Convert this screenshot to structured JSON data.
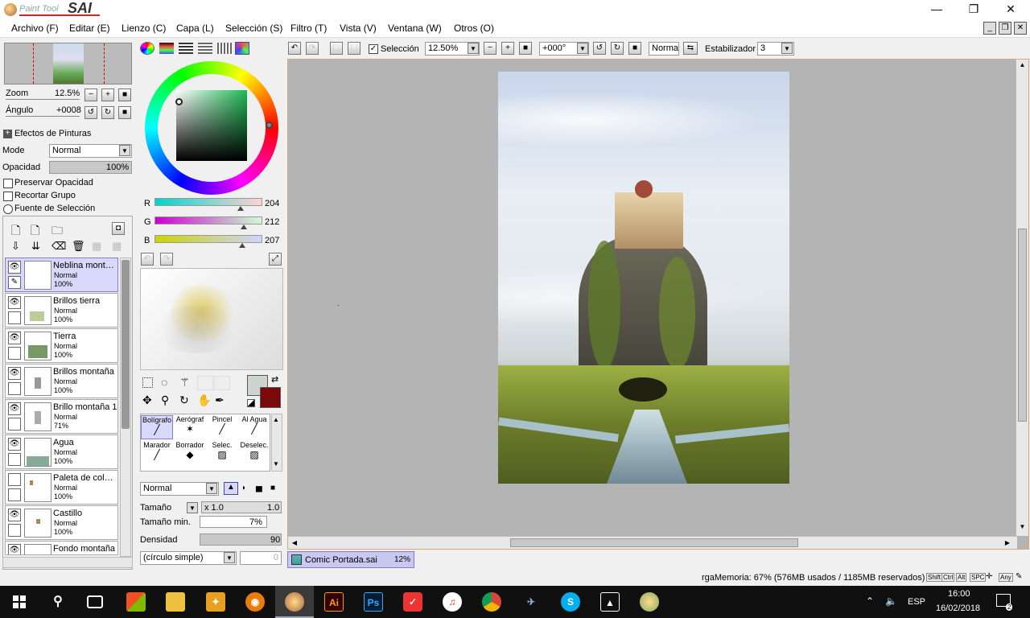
{
  "app": {
    "logo_small": "Paint Tool",
    "logo_big": "SAI"
  },
  "window_controls": {
    "minimize": "—",
    "maximize": "❐",
    "close": "✕"
  },
  "menu": [
    "Archivo (F)",
    "Editar (E)",
    "Lienzo (C)",
    "Capa (L)",
    "Selección (S)",
    "Filtro (T)",
    "Vista (V)",
    "Ventana (W)",
    "Otros (O)"
  ],
  "navigator": {
    "zoom_label": "Zoom",
    "zoom_value": "12.5%",
    "angle_label": "Ángulo",
    "angle_value": "+0008"
  },
  "layer_props": {
    "effects_label": "Efectos de Pinturas",
    "mode_label": "Mode",
    "mode_value": "Normal",
    "opacity_label": "Opacidad",
    "opacity_value": "100%",
    "preserve_opacity": "Preservar Opacidad",
    "clip_group": "Recortar Grupo",
    "selection_source": "Fuente de Selección"
  },
  "layers": [
    {
      "name": "Neblina mont…",
      "mode": "Normal",
      "opacity": "100%",
      "selected": true
    },
    {
      "name": "Brillos tierra",
      "mode": "Normal",
      "opacity": "100%"
    },
    {
      "name": "Tierra",
      "mode": "Normal",
      "opacity": "100%"
    },
    {
      "name": "Brillos montaña",
      "mode": "Normal",
      "opacity": "100%"
    },
    {
      "name": "Brillo montaña 1",
      "mode": "Normal",
      "opacity": "71%"
    },
    {
      "name": "Agua",
      "mode": "Normal",
      "opacity": "100%"
    },
    {
      "name": "Paleta de col…",
      "mode": "Normal",
      "opacity": "100%"
    },
    {
      "name": "Castillo",
      "mode": "Normal",
      "opacity": "100%"
    },
    {
      "name": "Fondo montaña",
      "mode": "",
      "opacity": ""
    }
  ],
  "color": {
    "r_label": "R",
    "r_value": "204",
    "r_level": 0.8,
    "g_label": "G",
    "g_value": "212",
    "g_level": 0.83,
    "b_label": "B",
    "b_value": "207",
    "b_level": 0.81,
    "fg": "#ccd4cf",
    "bg": "#7a0a0a"
  },
  "tools": [
    {
      "label": "Bolígrafo",
      "selected": true
    },
    {
      "label": "Aerógraf"
    },
    {
      "label": "Pincel"
    },
    {
      "label": "Al Agua"
    },
    {
      "label": "Marador"
    },
    {
      "label": "Borrador"
    },
    {
      "label": "Selec."
    },
    {
      "label": "Deselec."
    }
  ],
  "brush": {
    "blend_value": "Normal",
    "size_label": "Tamaño",
    "size_mult": "x 1.0",
    "size_value": "1.0",
    "min_size_label": "Tamaño min.",
    "min_size_value": "7%",
    "density_label": "Densidad",
    "density_value": "90",
    "shape_value": "(círculo simple)",
    "shape_amount": "0"
  },
  "toolbar": {
    "selection_label": "Selección",
    "zoom_value": "12.50%",
    "angle_value": "+000°",
    "blend_value": "Normal",
    "stabilizer_label": "Estabilizador",
    "stabilizer_value": "3"
  },
  "doc_tab": {
    "name": "Comic Portada.sai",
    "zoom": "12%"
  },
  "status": {
    "memory": "rgaMemoria: 67% (576MB usados / 1185MB reservados)",
    "keys": [
      "Shift",
      "Ctrl",
      "Alt",
      "SPC",
      "Any"
    ]
  },
  "taskbar": {
    "lang": "ESP",
    "time": "16:00",
    "date": "16/02/2018",
    "notif_count": "2"
  }
}
